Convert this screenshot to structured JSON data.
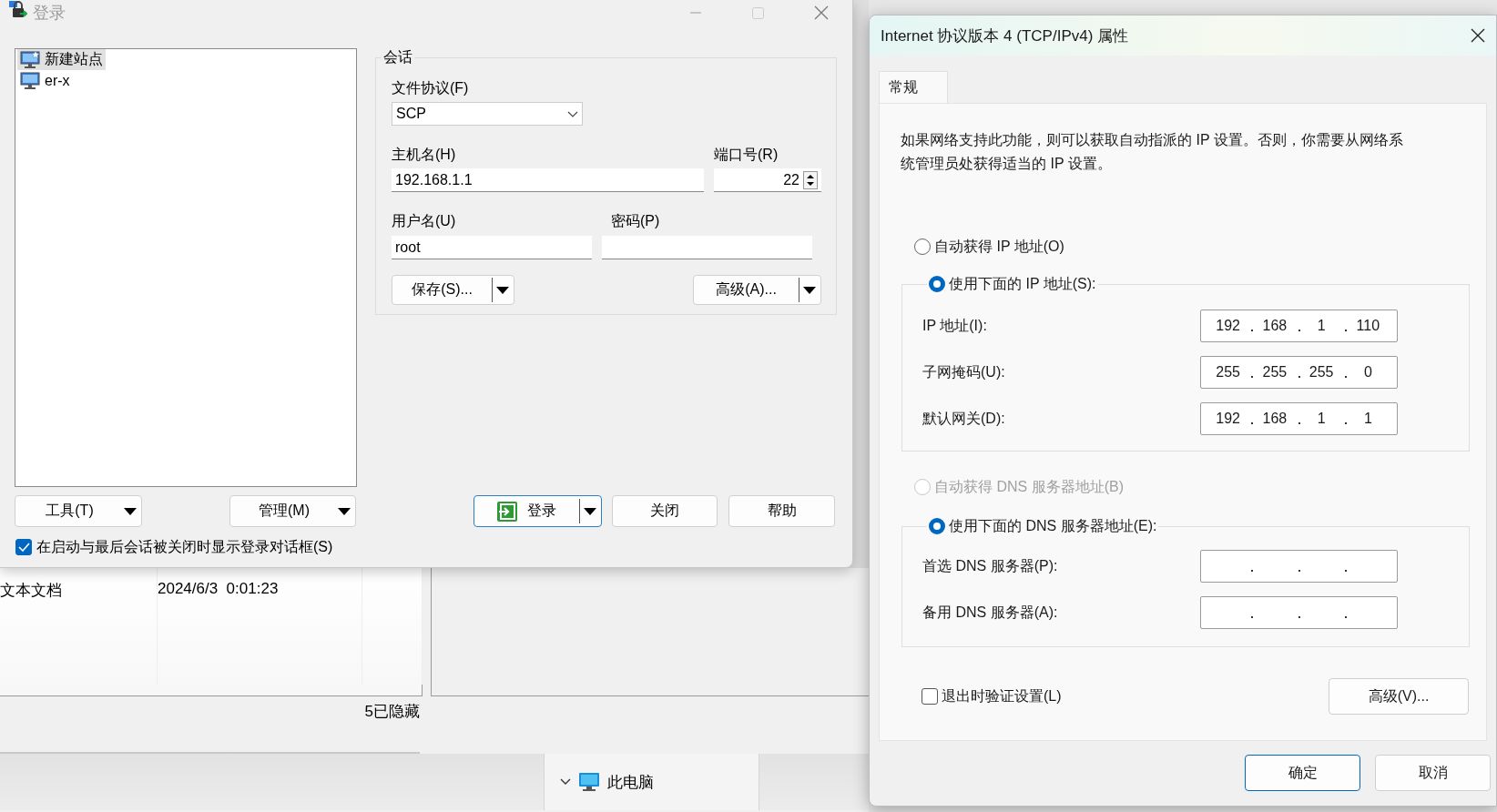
{
  "explorer": {
    "rows": [
      {
        "type": "文本文档",
        "date": "2024/6/3  0:01:23"
      }
    ],
    "status": "5已隐藏",
    "nav": [
      {
        "label": "此电脑",
        "expanded": true
      }
    ]
  },
  "login_window": {
    "title": "登录",
    "sites": [
      {
        "label": "新建站点",
        "kind": "new",
        "selected": true
      },
      {
        "label": "er-x",
        "kind": "site",
        "selected": false
      }
    ],
    "session": {
      "legend": "会话",
      "protocol_label": "文件协议(F)",
      "protocol": "SCP",
      "host_label": "主机名(H)",
      "host": "192.168.1.1",
      "port_label": "端口号(R)",
      "port": "22",
      "user_label": "用户名(U)",
      "user": "root",
      "password_label": "密码(P)",
      "save_button": "保存(S)...",
      "advanced_button": "高级(A)..."
    },
    "buttons": [
      {
        "label": "工具(T)",
        "kind": "menu"
      },
      {
        "label": "管理(M)",
        "kind": "menu"
      },
      {
        "label": "登录",
        "kind": "login"
      },
      {
        "label": "关闭",
        "kind": "plain"
      },
      {
        "label": "帮助",
        "kind": "plain"
      }
    ],
    "show_on_startup": {
      "label": "在启动与最后会话被关闭时显示登录对话框(S)",
      "checked": true
    }
  },
  "ipv4_dialog": {
    "title": "Internet 协议版本 4 (TCP/IPv4) 属性",
    "tabs": [
      {
        "label": "常规",
        "selected": true
      }
    ],
    "description": "如果网络支持此功能，则可以获取自动指派的 IP 设置。否则，你需要从网络系统管理员处获得适当的 IP 设置。",
    "ip_mode": [
      {
        "label": "自动获得 IP 地址(O)",
        "selected": false,
        "disabled": false
      },
      {
        "label": "使用下面的 IP 地址(S):",
        "selected": true,
        "disabled": false
      }
    ],
    "ip_fields": [
      {
        "label": "IP 地址(I):",
        "octets": [
          "192",
          "168",
          "1",
          "110"
        ]
      },
      {
        "label": "子网掩码(U):",
        "octets": [
          "255",
          "255",
          "255",
          "0"
        ]
      },
      {
        "label": "默认网关(D):",
        "octets": [
          "192",
          "168",
          "1",
          "1"
        ]
      }
    ],
    "dns_mode": [
      {
        "label": "自动获得 DNS 服务器地址(B)",
        "selected": false,
        "disabled": true
      },
      {
        "label": "使用下面的 DNS 服务器地址(E):",
        "selected": true,
        "disabled": false
      }
    ],
    "dns_fields": [
      {
        "label": "首选 DNS 服务器(P):"
      },
      {
        "label": "备用 DNS 服务器(A):"
      }
    ],
    "validate_on_exit": {
      "label": "退出时验证设置(L)",
      "checked": false
    },
    "advanced_button": "高级(V)...",
    "buttons": [
      "确定",
      "取消"
    ]
  }
}
